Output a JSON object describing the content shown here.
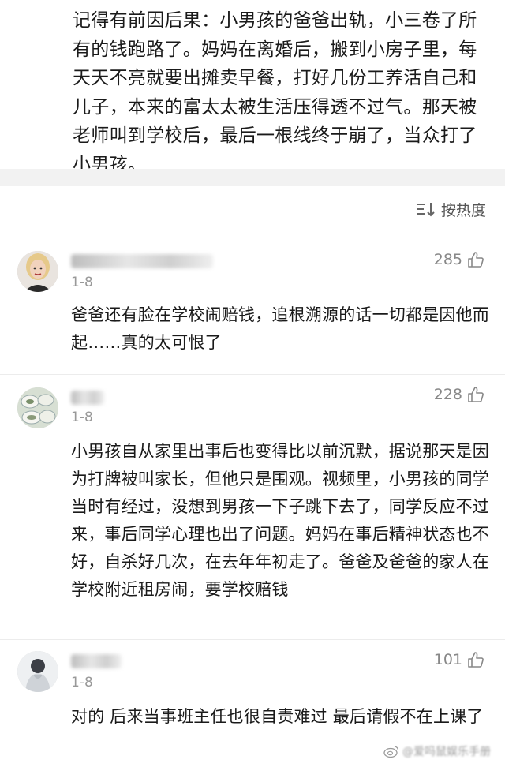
{
  "post": {
    "text": "记得有前因后果：小男孩的爸爸出轨，小三卷了所有的钱跑路了。妈妈在离婚后，搬到小房子里，每天天不亮就要出摊卖早餐，打好几份工养活自己和儿子，本来的富太太被生活压得透不过气。那天被老师叫到学校后，最后一根线终于崩了，当众打了小男孩。"
  },
  "sort": {
    "label": "按热度",
    "icon": "sort-icon"
  },
  "comments": [
    {
      "date": "1-8",
      "likes": "285",
      "text": "爸爸还有脸在学校闹赔钱，追根溯源的话一切都是因他而起……真的太可恨了",
      "avatar": "avatar-woman-blonde"
    },
    {
      "date": "1-8",
      "likes": "228",
      "text": "小男孩自从家里出事后也变得比以前沉默，据说那天是因为打牌被叫家长，但他只是围观。视频里，小男孩的同学当时有经过，没想到男孩一下子跳下去了，同学反应不过来，事后同学心理也出了问题。妈妈在事后精神状态也不好，自杀好几次，在去年年初走了。爸爸及爸爸的家人在学校附近租房闹，要学校赔钱",
      "avatar": "avatar-bowls"
    },
    {
      "date": "1-8",
      "likes": "101",
      "text": "对的 后来当事班主任也很自责难过 最后请假不在上课了",
      "avatar": "avatar-person-hoodie"
    }
  ],
  "watermark": {
    "text": "@爱吗鼠娱乐手册",
    "icon": "weibo-icon"
  }
}
